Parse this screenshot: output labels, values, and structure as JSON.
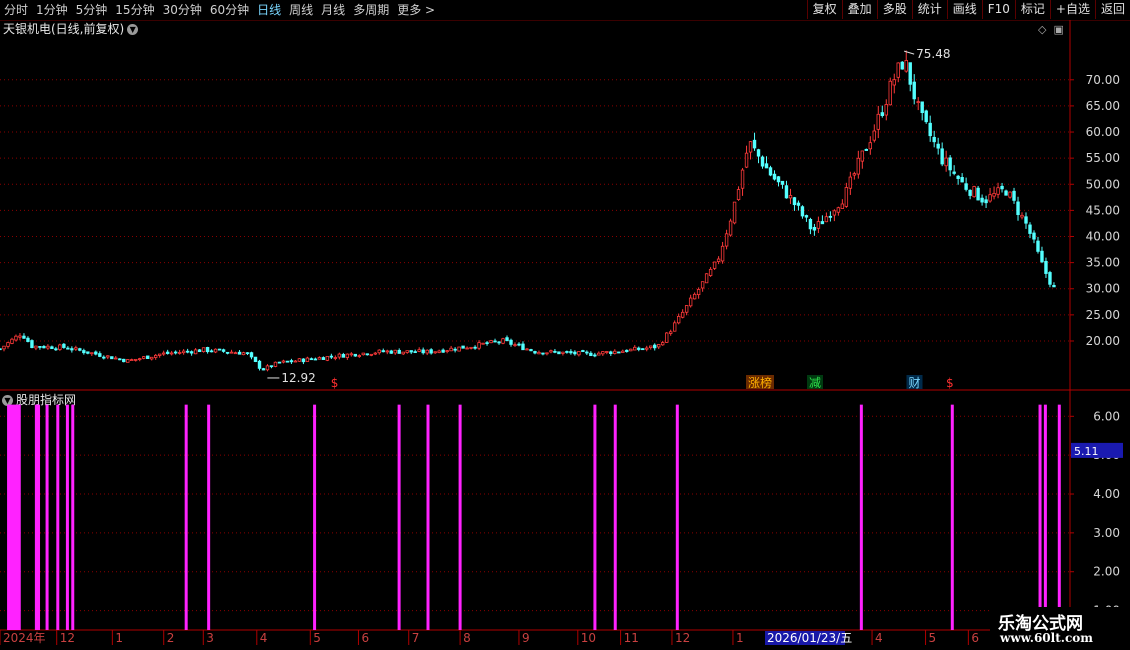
{
  "toolbar": {
    "periods": [
      "分时",
      "1分钟",
      "5分钟",
      "15分钟",
      "30分钟",
      "60分钟",
      "日线",
      "周线",
      "月线",
      "多周期",
      "更多"
    ],
    "active_period": "日线",
    "more_arrow": ">",
    "right_buttons": [
      "复权",
      "叠加",
      "多股",
      "统计",
      "画线",
      "F10",
      "标记",
      "+自选",
      "返回"
    ]
  },
  "main_chart": {
    "title": "天银机电(日线,前复权)",
    "max_label": "75.48",
    "min_label": "12.92",
    "event_markers": [
      "$",
      "涨榜",
      "减",
      "财",
      "$"
    ]
  },
  "indicator_panel": {
    "title": "股朋指标网",
    "current_value": "5.11"
  },
  "x_axis": {
    "labels": [
      "2024年",
      "12",
      "1",
      "2",
      "3",
      "4",
      "5",
      "6",
      "7",
      "8",
      "9",
      "10",
      "11",
      "12",
      "1",
      "4",
      "5",
      "6"
    ],
    "cursor_date": "2026/01/23/五"
  },
  "watermark": {
    "line1": "乐淘公式网",
    "line2": "www.60lt.com"
  },
  "colors": {
    "up": "#ff3a3a",
    "down": "#54ffff",
    "signal": "#ff22ff",
    "grid": "#8a0000",
    "axis": "#b00000"
  },
  "chart_data": [
    {
      "type": "candlestick",
      "title": "天银机电(日线,前复权)",
      "y_ticks": [
        20,
        25,
        30,
        35,
        40,
        45,
        50,
        55,
        60,
        65,
        70
      ],
      "y_tick_labels": [
        "20.00",
        "25.00",
        "30.00",
        "35.00",
        "40.00",
        "45.00",
        "50.00",
        "55.00",
        "60.00",
        "65.00",
        "70.00"
      ],
      "ylim": [
        11,
        78
      ],
      "close_path": [
        [
          0,
          18.5
        ],
        [
          0.02,
          21.5
        ],
        [
          0.03,
          19
        ],
        [
          0.06,
          18.8
        ],
        [
          0.09,
          17.5
        ],
        [
          0.12,
          16.2
        ],
        [
          0.15,
          17.5
        ],
        [
          0.19,
          18.3
        ],
        [
          0.23,
          17.7
        ],
        [
          0.245,
          14.5
        ],
        [
          0.26,
          15.8
        ],
        [
          0.3,
          16.8
        ],
        [
          0.33,
          17.5
        ],
        [
          0.36,
          18
        ],
        [
          0.4,
          17.9
        ],
        [
          0.44,
          19
        ],
        [
          0.47,
          20
        ],
        [
          0.5,
          18
        ],
        [
          0.55,
          17.5
        ],
        [
          0.6,
          18.5
        ],
        [
          0.615,
          19
        ],
        [
          0.63,
          23
        ],
        [
          0.67,
          35
        ],
        [
          0.685,
          45
        ],
        [
          0.7,
          58
        ],
        [
          0.72,
          52
        ],
        [
          0.74,
          47
        ],
        [
          0.76,
          41
        ],
        [
          0.79,
          48
        ],
        [
          0.82,
          62
        ],
        [
          0.835,
          70
        ],
        [
          0.845,
          74
        ],
        [
          0.86,
          63
        ],
        [
          0.88,
          55
        ],
        [
          0.9,
          50
        ],
        [
          0.92,
          47
        ],
        [
          0.94,
          49
        ],
        [
          0.96,
          42
        ],
        [
          0.975,
          34
        ],
        [
          0.985,
          30
        ]
      ],
      "max_point": {
        "x": 0.845,
        "y": 75.48,
        "label": "75.48"
      },
      "min_point": {
        "x": 0.248,
        "y": 12.92,
        "label": "12.92"
      }
    },
    {
      "type": "bar",
      "title": "股朋指标网",
      "y_ticks": [
        1,
        2,
        3,
        4,
        5,
        6
      ],
      "y_tick_labels": [
        "1.00",
        "2.00",
        "3.00",
        "4.00",
        "5.00",
        "6.00"
      ],
      "ylim": [
        0.5,
        6.6
      ],
      "current_value": 5.11,
      "signal_x": [
        0.008,
        0.01,
        0.012,
        0.014,
        0.016,
        0.018,
        0.034,
        0.036,
        0.044,
        0.054,
        0.063,
        0.068,
        0.174,
        0.195,
        0.294,
        0.373,
        0.4,
        0.43,
        0.556,
        0.575,
        0.633,
        0.805,
        0.89,
        0.972,
        0.977,
        0.99
      ],
      "signal_value": 6.3
    }
  ]
}
